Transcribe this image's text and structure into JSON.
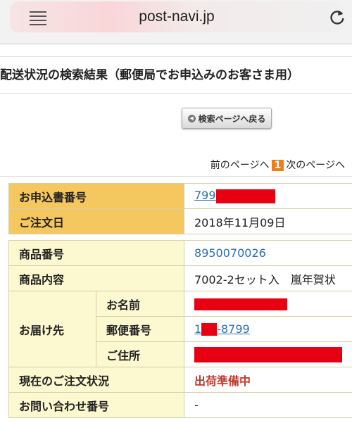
{
  "browser": {
    "url": "post-navi.jp",
    "menu_icon": "hamburger-menu-icon",
    "reload_icon": "reload-icon"
  },
  "page": {
    "heading": "配送状況の検索結果（郵便局でお申込みのお客さま用）",
    "back_button": "検索ページへ戻る",
    "pager": {
      "prev": "前のページへ",
      "current": "1",
      "next": "次のページへ"
    }
  },
  "order": {
    "order_no_label": "お申込書番号",
    "order_no_value": "799",
    "order_date_label": "ご注文日",
    "order_date_value": "2018年11月09日"
  },
  "detail": {
    "product_no_label": "商品番号",
    "product_no_value": "8950070026",
    "product_content_label": "商品内容",
    "product_content_value": "7002-2セット入　嵐年賀状",
    "delivery_label": "お届け先",
    "name_label": "お名前",
    "postal_label": "郵便番号",
    "postal_prefix": "1",
    "postal_suffix": "-8799",
    "address_label": "ご住所",
    "status_label": "現在のご注文状況",
    "status_value": "出荷準備中",
    "inquiry_label": "お問い合わせ番号",
    "inquiry_value": "-"
  },
  "colors": {
    "label_orange": "#f5c75f",
    "label_yellow": "#fcf8cf",
    "redaction": "#e60012",
    "status_red": "#c0392b",
    "link": "#2c6fad"
  }
}
